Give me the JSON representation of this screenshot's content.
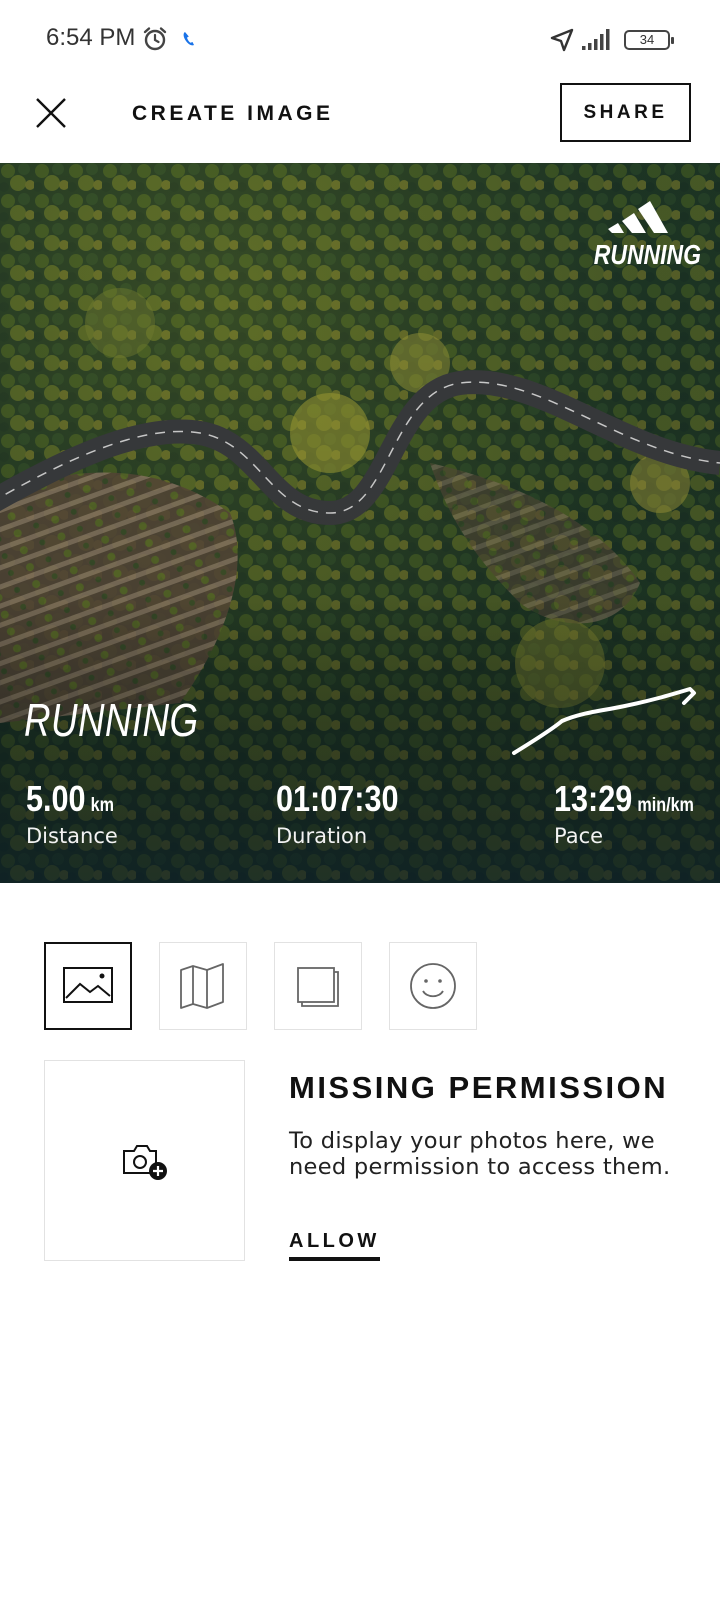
{
  "status_bar": {
    "time": "6:54 PM",
    "battery_level": "34",
    "icons": [
      "alarm-icon",
      "call-icon",
      "navigation-icon",
      "signal-icon",
      "battery-icon"
    ]
  },
  "header": {
    "title": "CREATE IMAGE",
    "share_label": "SHARE",
    "close_icon": "close-icon"
  },
  "preview": {
    "brand_label": "RUNNING",
    "activity_title": "RUNNING",
    "stats": {
      "distance": {
        "value": "5.00",
        "unit": "km",
        "label": "Distance"
      },
      "duration": {
        "value": "01:07:30",
        "unit": "",
        "label": "Duration"
      },
      "pace": {
        "value": "13:29",
        "unit": "min/km",
        "label": "Pace"
      }
    }
  },
  "tabs": [
    {
      "icon": "image-icon",
      "active": true
    },
    {
      "icon": "map-icon",
      "active": false
    },
    {
      "icon": "layers-icon",
      "active": false
    },
    {
      "icon": "smiley-icon",
      "active": false
    }
  ],
  "permission": {
    "title": "MISSING PERMISSION",
    "body": "To display your photos here, we need permission to access them.",
    "allow_label": "ALLOW",
    "icon": "add-photo-icon"
  },
  "colors": {
    "accent": "#111111",
    "tab_border": "#e2e2e2",
    "call_icon": "#1a73e8"
  }
}
